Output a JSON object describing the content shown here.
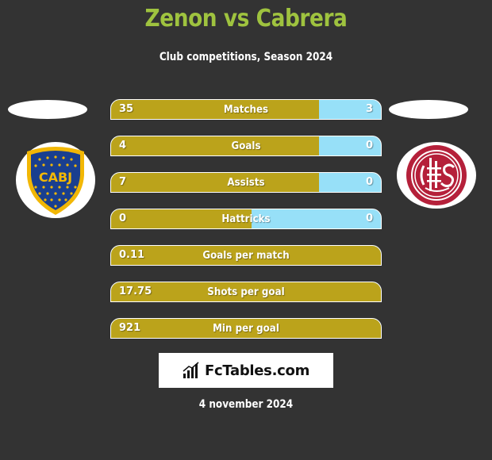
{
  "header": {
    "title": "Zenon vs Cabrera",
    "subtitle": "Club competitions, Season 2024"
  },
  "players": {
    "left": {
      "name": "Zenon",
      "club_logo": "boca-juniors-crest",
      "logo_text": "CABJ"
    },
    "right": {
      "name": "Cabrera",
      "club_logo": "lanus-crest"
    }
  },
  "colors": {
    "title": "#9fc33f",
    "left_bar": "#bba31b",
    "right_bar": "#97e0f8",
    "background": "#333333"
  },
  "stats": [
    {
      "label": "Matches",
      "left": "35",
      "right": "3",
      "left_fraction": 0.77
    },
    {
      "label": "Goals",
      "left": "4",
      "right": "0",
      "left_fraction": 0.77
    },
    {
      "label": "Assists",
      "left": "7",
      "right": "0",
      "left_fraction": 0.77
    },
    {
      "label": "Hattricks",
      "left": "0",
      "right": "0",
      "left_fraction": 0.52
    },
    {
      "label": "Goals per match",
      "left": "0.11",
      "right": "",
      "left_fraction": 1
    },
    {
      "label": "Shots per goal",
      "left": "17.75",
      "right": "",
      "left_fraction": 1
    },
    {
      "label": "Min per goal",
      "left": "921",
      "right": "",
      "left_fraction": 1
    }
  ],
  "brand": {
    "name": "FcTables.com",
    "icon": "bar-chart-icon"
  },
  "footer": {
    "date": "4 november 2024"
  }
}
